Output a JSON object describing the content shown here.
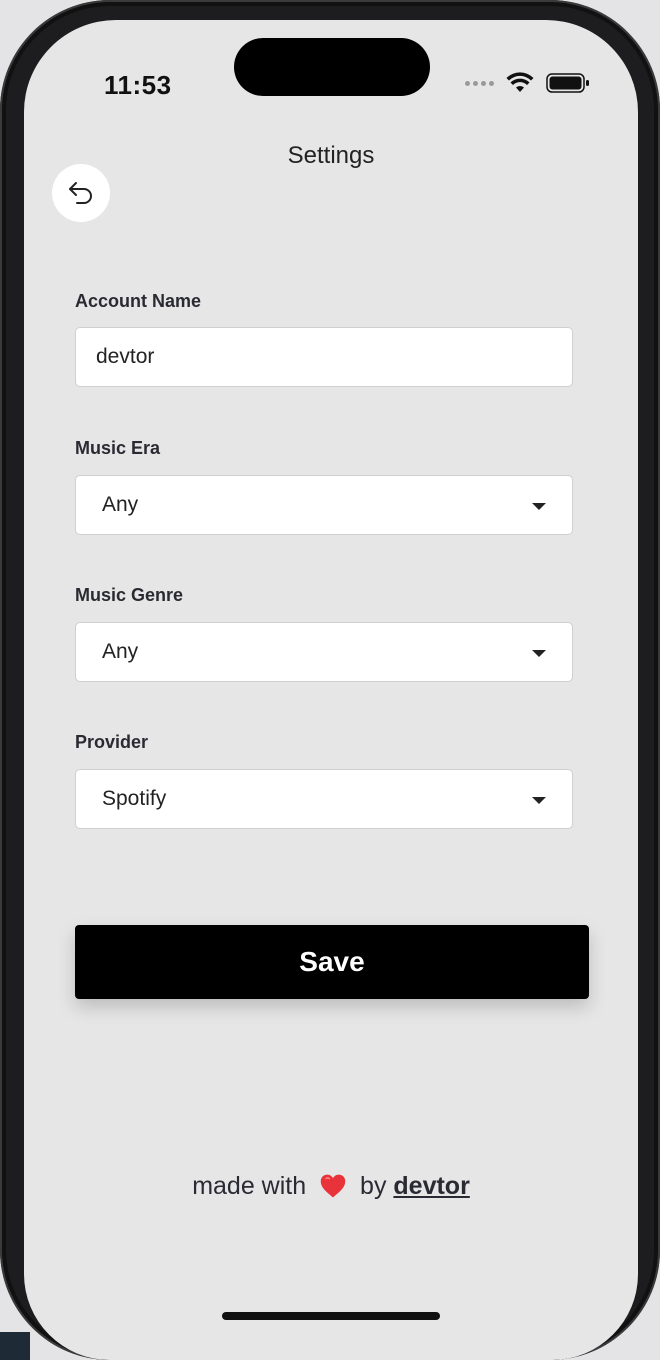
{
  "status_bar": {
    "time": "11:53"
  },
  "header": {
    "title": "Settings",
    "back_icon": "undo-arrow-icon"
  },
  "form": {
    "account_name": {
      "label": "Account Name",
      "value": "devtor"
    },
    "music_era": {
      "label": "Music Era",
      "selected": "Any"
    },
    "music_genre": {
      "label": "Music Genre",
      "selected": "Any"
    },
    "provider": {
      "label": "Provider",
      "selected": "Spotify"
    }
  },
  "save_button": {
    "label": "Save"
  },
  "footer": {
    "prefix": "made with",
    "heart_icon": "heart-icon",
    "by": "by",
    "link": "devtor"
  },
  "colors": {
    "screen_bg": "#e6e6e6",
    "primary_button": "#000000",
    "text": "#2a2a33"
  }
}
